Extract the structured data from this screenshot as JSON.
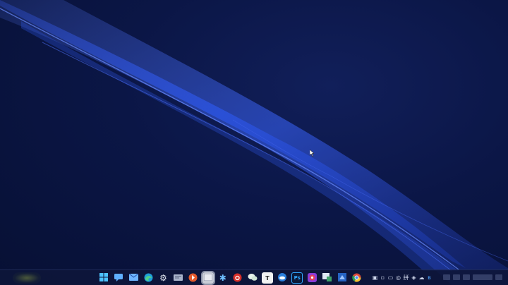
{
  "desktop": {
    "wallpaper": "windows-11-blue-ribbon",
    "colors": {
      "background": "#0b1646",
      "ribbon": "#2e56e0",
      "taskbar": "#0e163a"
    }
  },
  "taskbar": {
    "apps": [
      {
        "name": "start-icon",
        "glyph": "",
        "bg": "#1e6fd9"
      },
      {
        "name": "chat-icon",
        "glyph": "",
        "bg": "#2b7de0"
      },
      {
        "name": "mail-icon",
        "glyph": "",
        "bg": "#3c7ed6"
      },
      {
        "name": "edge-icon",
        "glyph": "",
        "bg": "#1b9c7c"
      },
      {
        "name": "settings-icon",
        "glyph": "⚙",
        "bg": "#5b6478"
      },
      {
        "name": "file-manager-icon",
        "glyph": "",
        "bg": "#8896b4"
      },
      {
        "name": "music-app-icon",
        "glyph": "",
        "bg": "#e2552b"
      },
      {
        "name": "blank-window-icon",
        "glyph": "",
        "bg": "#c8ccd6"
      },
      {
        "name": "bluetooth-app-icon",
        "glyph": "✱",
        "bg": "#1c6fd0"
      },
      {
        "name": "netease-music-icon",
        "glyph": "",
        "bg": "#d2322c"
      },
      {
        "name": "wechat-icon",
        "glyph": "",
        "bg": "#2c8f4a"
      },
      {
        "name": "typora-icon",
        "glyph": "T",
        "bg": "#f2f2f2"
      },
      {
        "name": "cloud-app-icon",
        "glyph": "",
        "bg": "#1f6fc8"
      },
      {
        "name": "photoshop-icon",
        "glyph": "Ps",
        "bg": "#0b1a3a"
      },
      {
        "name": "red-app-icon",
        "glyph": "",
        "bg": "#d53a5a"
      },
      {
        "name": "remote-desktop-icon",
        "glyph": "",
        "bg": "#4aa06a"
      },
      {
        "name": "blue-square-app-icon",
        "glyph": "",
        "bg": "#2563c2"
      },
      {
        "name": "chrome-icon",
        "glyph": "",
        "bg": "#dd4a3a"
      }
    ],
    "tray": [
      {
        "name": "tray-app-icon",
        "glyph": "▣"
      },
      {
        "name": "tray-window-icon",
        "glyph": "▫"
      },
      {
        "name": "tray-keyboard-icon",
        "glyph": "▭"
      },
      {
        "name": "tray-wechat-icon",
        "glyph": "◎"
      },
      {
        "name": "tray-input-icon",
        "glyph": "拼"
      },
      {
        "name": "tray-shield-icon",
        "glyph": "◈"
      },
      {
        "name": "tray-cloud-icon",
        "glyph": "☁"
      },
      {
        "name": "tray-bluetooth-icon",
        "glyph": "ʙ"
      }
    ]
  }
}
